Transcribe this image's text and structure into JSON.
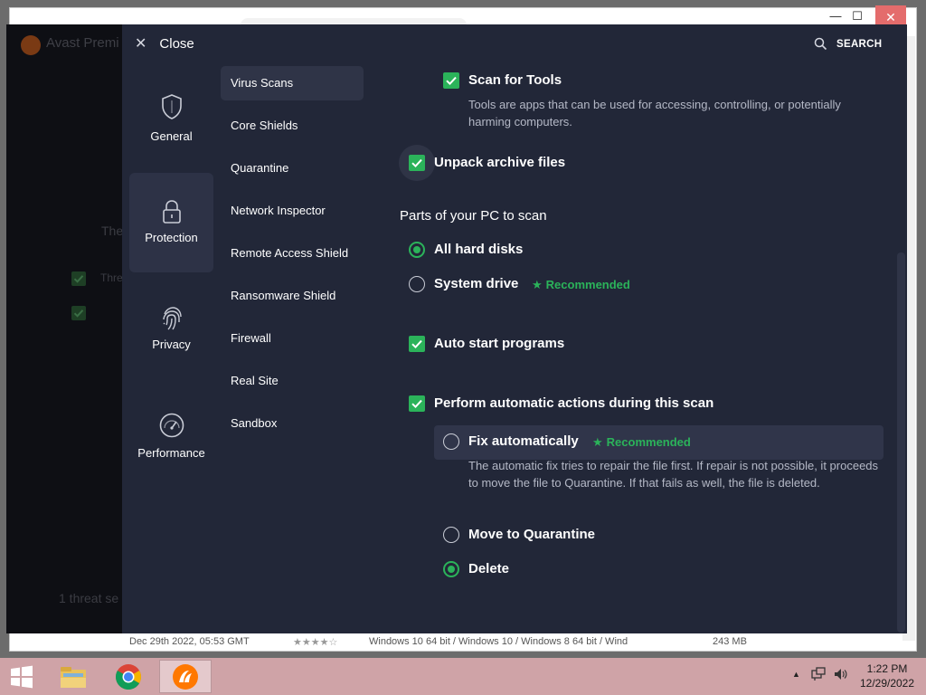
{
  "window": {
    "min_icon": "minimize-icon",
    "max_icon": "maximize-icon",
    "close_icon": "close-icon"
  },
  "background_app": {
    "title": "Avast Premi",
    "faint_text_1": "The",
    "faint_text_2": "Thre",
    "footer_text": "1 threat se",
    "list_row": {
      "date": "Dec 29th 2022, 05:53 GMT",
      "platforms": "Windows 10 64 bit / Windows 10 / Windows 8 64 bit / Wind",
      "size": "243 MB"
    }
  },
  "header": {
    "close_label": "Close",
    "search_label": "SEARCH"
  },
  "categories": [
    {
      "label": "General",
      "icon": "shield-icon"
    },
    {
      "label": "Protection",
      "icon": "lock-icon"
    },
    {
      "label": "Privacy",
      "icon": "fingerprint-icon"
    },
    {
      "label": "Performance",
      "icon": "speedometer-icon"
    }
  ],
  "sub_items": [
    "Virus Scans",
    "Core Shields",
    "Quarantine",
    "Network Inspector",
    "Remote Access Shield",
    "Ransomware Shield",
    "Firewall",
    "Real Site",
    "Sandbox"
  ],
  "content": {
    "scan_tools": {
      "label": "Scan for Tools",
      "checked": true,
      "desc": "Tools are apps that can be used for accessing, controlling, or potentially harming computers."
    },
    "unpack_archive": {
      "label": "Unpack archive files",
      "checked": true
    },
    "parts_title": "Parts of your PC to scan",
    "all_hard_disks": {
      "label": "All hard disks",
      "selected": true
    },
    "system_drive": {
      "label": "System drive",
      "selected": false,
      "badge": "Recommended"
    },
    "auto_start": {
      "label": "Auto start programs",
      "checked": true
    },
    "perform_actions": {
      "label": "Perform automatic actions during this scan",
      "checked": true
    },
    "fix_auto": {
      "label": "Fix automatically",
      "selected": false,
      "badge": "Recommended",
      "desc": "The automatic fix tries to repair the file first. If repair is not possible, it proceeds to move the file to Quarantine. If that fails as well, the file is deleted."
    },
    "move_quarantine": {
      "label": "Move to Quarantine",
      "selected": false
    },
    "delete": {
      "label": "Delete",
      "selected": true
    }
  },
  "taskbar": {
    "apps": [
      "start-icon",
      "file-explorer-icon",
      "chrome-icon",
      "avast-icon"
    ],
    "time": "1:22 PM",
    "date": "12/29/2022"
  },
  "colors": {
    "accent_green": "#2bb35a",
    "panel_bg": "#222738",
    "active_item_bg": "#2f3447"
  }
}
